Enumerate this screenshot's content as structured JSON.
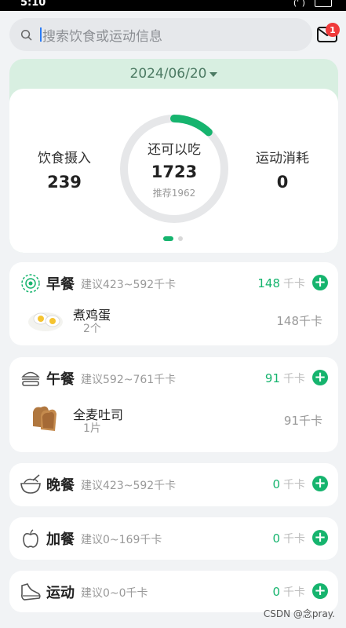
{
  "status": {
    "time": "5:10",
    "signal": "(' )"
  },
  "search": {
    "placeholder": "搜索饮食或运动信息"
  },
  "mail": {
    "badge": "1"
  },
  "summary": {
    "date": "2024/06/20",
    "intake_label": "饮食摄入",
    "intake_value": "239",
    "remaining_label": "还可以吃",
    "remaining_value": "1723",
    "recommend": "推荐1962",
    "burn_label": "运动消耗",
    "burn_value": "0",
    "progress_fraction": 0.12,
    "accent": "#16b46e"
  },
  "meals": [
    {
      "title": "早餐",
      "hint": "建议423~592千卡",
      "kcal": "148",
      "unit": "千卡",
      "items": [
        {
          "name": "煮鸡蛋",
          "qty": "2个",
          "kcal": "148千卡"
        }
      ]
    },
    {
      "title": "午餐",
      "hint": "建议592~761千卡",
      "kcal": "91",
      "unit": "千卡",
      "items": [
        {
          "name": "全麦吐司",
          "qty": "1片",
          "kcal": "91千卡"
        }
      ]
    },
    {
      "title": "晚餐",
      "hint": "建议423~592千卡",
      "kcal": "0",
      "unit": "千卡",
      "items": []
    },
    {
      "title": "加餐",
      "hint": "建议0~169千卡",
      "kcal": "0",
      "unit": "千卡",
      "items": []
    },
    {
      "title": "运动",
      "hint": "建议0~0千卡",
      "kcal": "0",
      "unit": "千卡",
      "items": []
    }
  ],
  "watermark": "CSDN @念pray."
}
